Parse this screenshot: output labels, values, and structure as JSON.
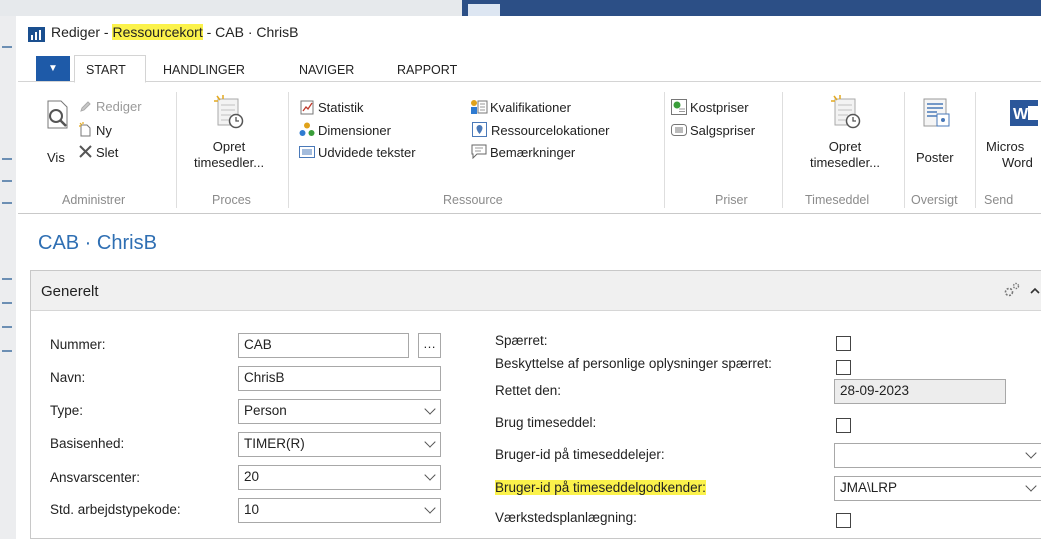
{
  "window": {
    "title_prefix": "Rediger - ",
    "title_highlight": "Ressourcekort",
    "title_suffix": " - CAB · ChrisB"
  },
  "tabs": {
    "start": "START",
    "handlinger": "HANDLINGER",
    "naviger": "NAVIGER",
    "rapport": "RAPPORT"
  },
  "ribbon": {
    "administrer": {
      "group": "Administrer",
      "vis": "Vis",
      "rediger": "Rediger",
      "ny": "Ny",
      "slet": "Slet"
    },
    "proces": {
      "group": "Proces",
      "opret_line1": "Opret",
      "opret_line2": "timesedler..."
    },
    "ressource": {
      "group": "Ressource",
      "statistik": "Statistik",
      "dimensioner": "Dimensioner",
      "udvidede": "Udvidede tekster",
      "kvalifikationer": "Kvalifikationer",
      "lokationer": "Ressourcelokationer",
      "bemaerkninger": "Bemærkninger"
    },
    "priser": {
      "group": "Priser",
      "kostpriser": "Kostpriser",
      "salgspriser": "Salgspriser"
    },
    "timeseddel": {
      "group": "Timeseddel",
      "opret_line1": "Opret",
      "opret_line2": "timesedler..."
    },
    "oversigt": {
      "group": "Oversigt",
      "poster": "Poster"
    },
    "send": {
      "group": "Send",
      "word_line1": "Micros",
      "word_line2": "Word"
    }
  },
  "page": {
    "title": "CAB · ChrisB"
  },
  "panel": {
    "title": "Generelt"
  },
  "left_fields": {
    "nummer": {
      "label": "Nummer:",
      "value": "CAB"
    },
    "navn": {
      "label": "Navn:",
      "value": "ChrisB"
    },
    "type": {
      "label": "Type:",
      "value": "Person"
    },
    "basisenhed": {
      "label": "Basisenhed:",
      "value": "TIMER(R)"
    },
    "ansvarscenter": {
      "label": "Ansvarscenter:",
      "value": "20"
    },
    "arbejdstype": {
      "label": "Std. arbejdstypekode:",
      "value": "10"
    }
  },
  "right_fields": {
    "spaerret": {
      "label": "Spærret:",
      "checked": false
    },
    "beskyttelse": {
      "label": "Beskyttelse af personlige oplysninger spærret:",
      "checked": false
    },
    "rettet": {
      "label": "Rettet den:",
      "value": "28-09-2023"
    },
    "brug": {
      "label": "Brug timeseddel:",
      "checked": false
    },
    "ejer": {
      "label": "Bruger-id på timeseddelejer:",
      "value": ""
    },
    "godkender": {
      "label": "Bruger-id på timeseddelgodkender:",
      "value": "JMA\\LRP"
    },
    "vaerksted": {
      "label": "Værkstedsplanlægning:",
      "checked": false
    }
  },
  "colors": {
    "accent": "#2f6fb3",
    "highlight": "#fbf24b",
    "tab_menu": "#1e5aa8"
  }
}
